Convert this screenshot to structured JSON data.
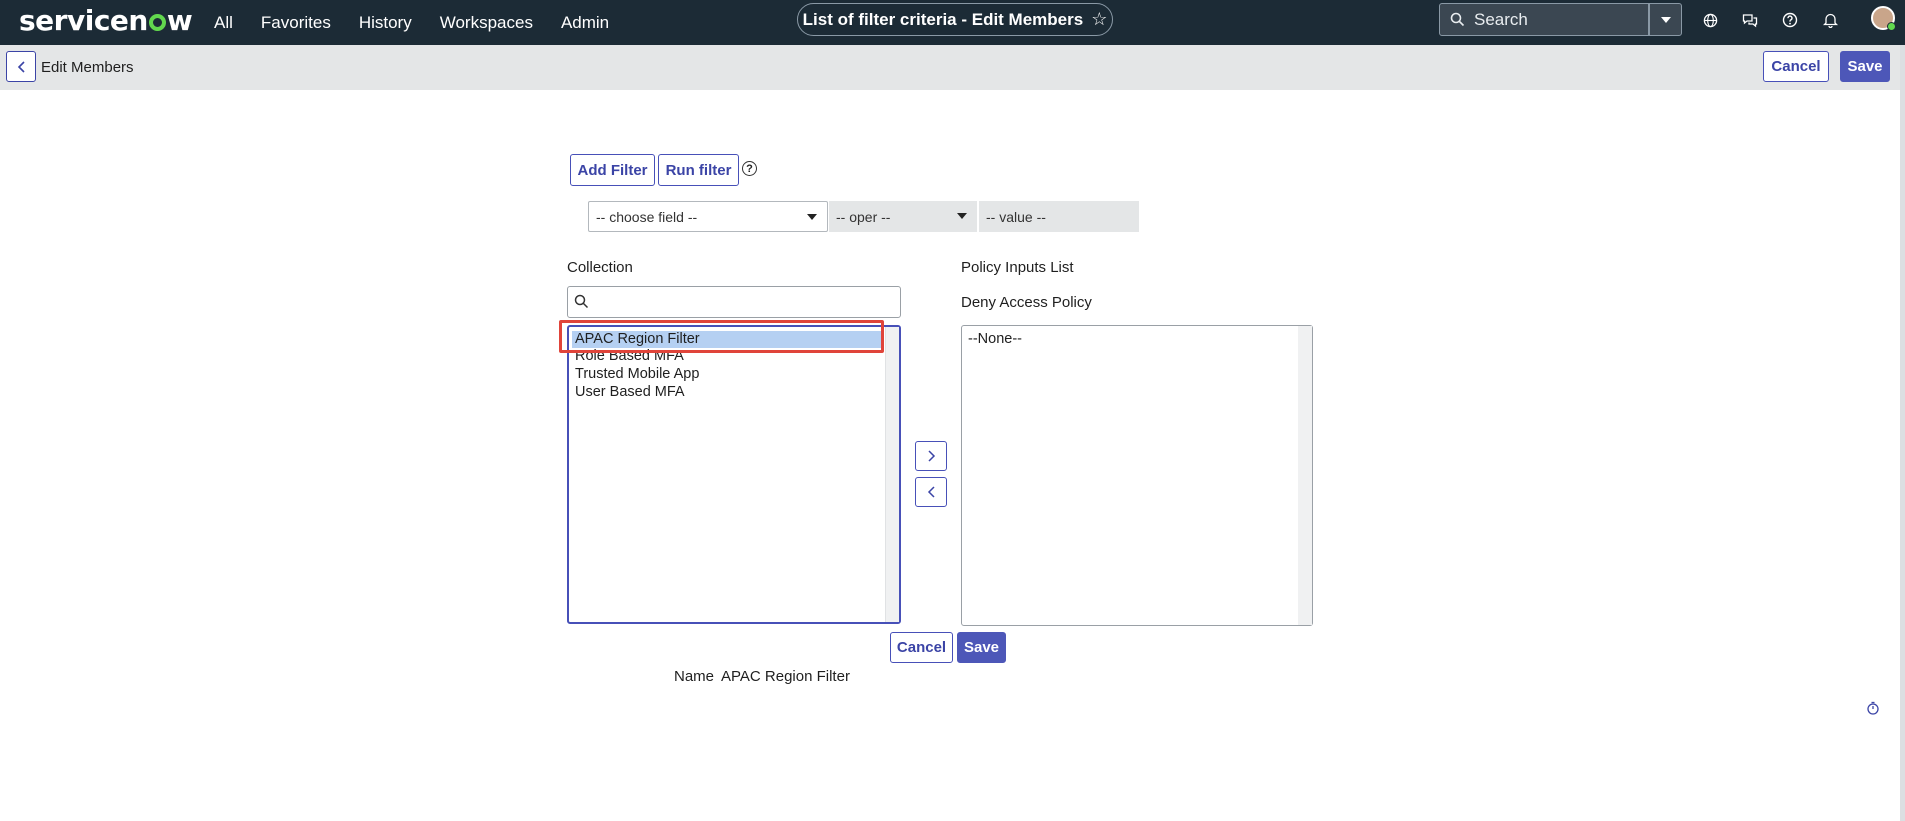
{
  "brand": {
    "logo_text_pre": "servicen",
    "logo_text_post": "w",
    "accent": "#62d84e"
  },
  "nav": {
    "links": [
      "All",
      "Favorites",
      "History",
      "Workspaces",
      "Admin"
    ],
    "page_title": "List of filter criteria - Edit Members",
    "search_placeholder": "Search",
    "icons": [
      "globe-icon",
      "chat-icon",
      "help-icon",
      "bell-icon",
      "avatar"
    ]
  },
  "header": {
    "title": "Edit Members",
    "cancel_label": "Cancel",
    "save_label": "Save"
  },
  "filter": {
    "add_filter_label": "Add Filter",
    "run_filter_label": "Run filter",
    "field_select": "-- choose field --",
    "oper_select": "-- oper --",
    "value_placeholder": "-- value --"
  },
  "collection": {
    "label": "Collection",
    "items": [
      "APAC Region Filter",
      "Role Based MFA",
      "Trusted Mobile App",
      "User Based MFA"
    ],
    "selected_item": "APAC Region Filter"
  },
  "policy": {
    "list_label": "Policy Inputs List",
    "sub_label": "Deny Access Policy",
    "items": [
      "--None--"
    ]
  },
  "footer": {
    "cancel_label": "Cancel",
    "save_label": "Save",
    "name_label": "Name",
    "name_value": "APAC Region Filter"
  },
  "colors": {
    "nav_bg": "#1c2b36",
    "primary": "#4d57b8",
    "highlight_border": "#e0443a",
    "selection_bg": "#b5d0f2"
  }
}
